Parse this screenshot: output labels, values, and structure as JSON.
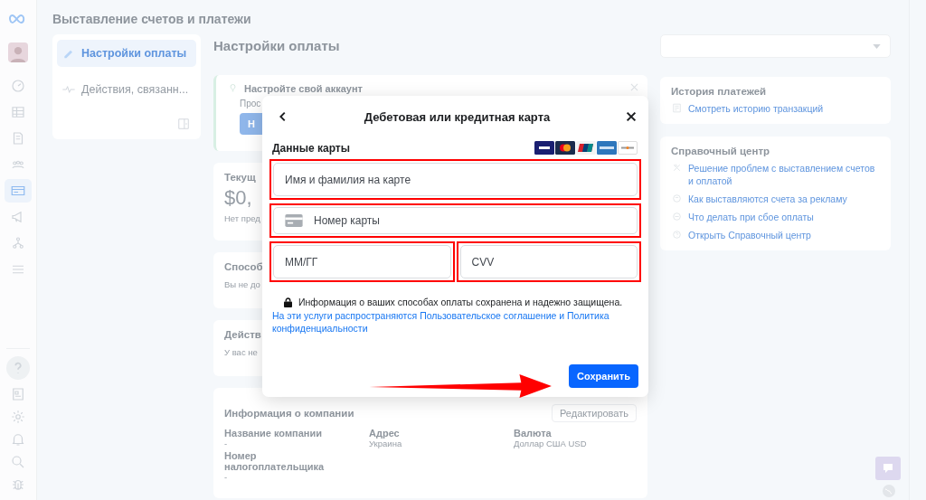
{
  "page_title": "Выставление счетов и платежи",
  "rail_items": [
    {
      "selected": false
    },
    {
      "selected": false
    },
    {
      "selected": false
    },
    {
      "selected": false
    },
    {
      "selected": true
    },
    {
      "selected": false
    },
    {
      "selected": false
    },
    {
      "selected": false
    }
  ],
  "nav": [
    {
      "label": "Настройки оплаты",
      "selected": true
    },
    {
      "label": "Действия, связанн...",
      "selected": false
    }
  ],
  "section_title": "Настройки оплаты",
  "setup_banner": {
    "title": "Настройте свой аккаунт",
    "text": "Проc",
    "button": "Н"
  },
  "cards": [
    {
      "title": "Текущ",
      "amount": "$0,",
      "note": "Нет пред"
    },
    {
      "title": "Способ",
      "note": "Вы не до"
    },
    {
      "title": "Действ",
      "note": "У вас не"
    }
  ],
  "company": {
    "title": "Информация о компании",
    "edit_button": "Редактировать",
    "fields": [
      {
        "label": "Название компании",
        "value": "-"
      },
      {
        "label": "Адрес",
        "value": "Украина"
      },
      {
        "label": "Валюта",
        "value": "Доллар США USD"
      },
      {
        "label": "Номер налогоплательщика",
        "value": "-"
      }
    ]
  },
  "history": {
    "title": "История платежей",
    "link": "Смотреть историю транзакций"
  },
  "help": {
    "title": "Справочный центр",
    "links": [
      "Решение проблем с выставлением счетов и оплатой",
      "Как выставляются счета за рекламу",
      "Что делать при сбое оплаты",
      "Открыть Справочный центр"
    ]
  },
  "modal": {
    "title": "Дебетовая или кредитная карта",
    "section": "Данные карты",
    "fields": [
      {
        "placeholder": "Имя и фамилия на карте",
        "kind": "name"
      },
      {
        "placeholder": "Номер карты",
        "kind": "card"
      },
      {
        "placeholder": "ММ/ГГ",
        "kind": "half"
      },
      {
        "placeholder": "CVV",
        "kind": "half"
      }
    ],
    "security_note": "Информация о ваших способах оплаты сохранена и надежно защищена.",
    "terms_link": "На эти услуги распространяются Пользовательское соглашение и Политика конфиденциальности",
    "save_button": "Сохранить"
  }
}
